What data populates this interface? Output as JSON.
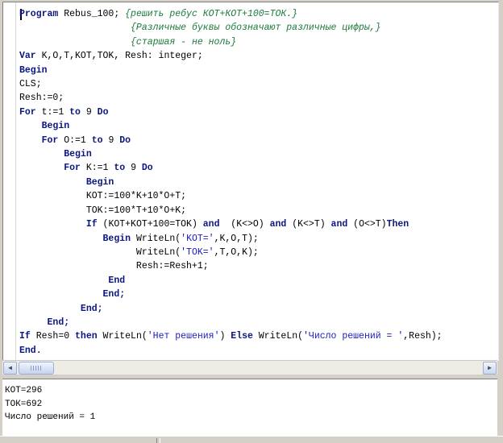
{
  "editor": {
    "lines": [
      [
        {
          "t": "Program",
          "c": "kw"
        },
        {
          "t": " Rebus_100; ",
          "c": "pl"
        },
        {
          "t": "{решить ребус КОТ+КОТ+100=ТОК.}",
          "c": "cm"
        }
      ],
      [
        {
          "t": "                    ",
          "c": "pl"
        },
        {
          "t": "{Различные буквы обозначают различные цифры,}",
          "c": "cm"
        }
      ],
      [
        {
          "t": "                    ",
          "c": "pl"
        },
        {
          "t": "{старшая - не ноль}",
          "c": "cm"
        }
      ],
      [
        {
          "t": "Var",
          "c": "kw"
        },
        {
          "t": " K,O,T,KOT,TOK, Resh: integer;",
          "c": "pl"
        }
      ],
      [
        {
          "t": "Begin",
          "c": "kw"
        }
      ],
      [
        {
          "t": "CLS;",
          "c": "pl"
        }
      ],
      [
        {
          "t": "Resh:=0;",
          "c": "pl"
        }
      ],
      [
        {
          "t": "For",
          "c": "kw"
        },
        {
          "t": " t:=1 ",
          "c": "pl"
        },
        {
          "t": "to",
          "c": "kw"
        },
        {
          "t": " 9 ",
          "c": "pl"
        },
        {
          "t": "Do",
          "c": "kw"
        }
      ],
      [
        {
          "t": "    ",
          "c": "pl"
        },
        {
          "t": "Begin",
          "c": "kw"
        }
      ],
      [
        {
          "t": "    ",
          "c": "pl"
        },
        {
          "t": "For",
          "c": "kw"
        },
        {
          "t": " O:=1 ",
          "c": "pl"
        },
        {
          "t": "to",
          "c": "kw"
        },
        {
          "t": " 9 ",
          "c": "pl"
        },
        {
          "t": "Do",
          "c": "kw"
        }
      ],
      [
        {
          "t": "        ",
          "c": "pl"
        },
        {
          "t": "Begin",
          "c": "kw"
        }
      ],
      [
        {
          "t": "        ",
          "c": "pl"
        },
        {
          "t": "For",
          "c": "kw"
        },
        {
          "t": " K:=1 ",
          "c": "pl"
        },
        {
          "t": "to",
          "c": "kw"
        },
        {
          "t": " 9 ",
          "c": "pl"
        },
        {
          "t": "Do",
          "c": "kw"
        }
      ],
      [
        {
          "t": "            ",
          "c": "pl"
        },
        {
          "t": "Begin",
          "c": "kw"
        }
      ],
      [
        {
          "t": "            KOT:=100*K+10*O+T;",
          "c": "pl"
        }
      ],
      [
        {
          "t": "            TOK:=100*T+10*O+K;",
          "c": "pl"
        }
      ],
      [
        {
          "t": "            ",
          "c": "pl"
        },
        {
          "t": "If",
          "c": "kw"
        },
        {
          "t": " (KOT+KOT+100=TOK) ",
          "c": "pl"
        },
        {
          "t": "and",
          "c": "kw"
        },
        {
          "t": "  (K<>O) ",
          "c": "pl"
        },
        {
          "t": "and",
          "c": "kw"
        },
        {
          "t": " (K<>T) ",
          "c": "pl"
        },
        {
          "t": "and",
          "c": "kw"
        },
        {
          "t": " (O<>T)",
          "c": "pl"
        },
        {
          "t": "Then",
          "c": "kw"
        }
      ],
      [
        {
          "t": "               ",
          "c": "pl"
        },
        {
          "t": "Begin",
          "c": "kw"
        },
        {
          "t": " WriteLn(",
          "c": "pl"
        },
        {
          "t": "'KOT='",
          "c": "st"
        },
        {
          "t": ",K,O,T);",
          "c": "pl"
        }
      ],
      [
        {
          "t": "                     WriteLn(",
          "c": "pl"
        },
        {
          "t": "'TOK='",
          "c": "st"
        },
        {
          "t": ",T,O,K);",
          "c": "pl"
        }
      ],
      [
        {
          "t": "                     Resh:=Resh+1;",
          "c": "pl"
        }
      ],
      [
        {
          "t": "                ",
          "c": "pl"
        },
        {
          "t": "End",
          "c": "kw"
        }
      ],
      [
        {
          "t": "               ",
          "c": "pl"
        },
        {
          "t": "End;",
          "c": "kw"
        }
      ],
      [
        {
          "t": "           ",
          "c": "pl"
        },
        {
          "t": "End;",
          "c": "kw"
        }
      ],
      [
        {
          "t": "     ",
          "c": "pl"
        },
        {
          "t": "End;",
          "c": "kw"
        }
      ],
      [
        {
          "t": "If",
          "c": "kw"
        },
        {
          "t": " Resh=0 ",
          "c": "pl"
        },
        {
          "t": "then",
          "c": "kw"
        },
        {
          "t": " WriteLn(",
          "c": "pl"
        },
        {
          "t": "'Нет решения'",
          "c": "st"
        },
        {
          "t": ") ",
          "c": "pl"
        },
        {
          "t": "Else",
          "c": "kw"
        },
        {
          "t": " WriteLn(",
          "c": "pl"
        },
        {
          "t": "'Число решений = '",
          "c": "st"
        },
        {
          "t": ",Resh);",
          "c": "pl"
        }
      ],
      [
        {
          "t": "End.",
          "c": "kw"
        }
      ]
    ]
  },
  "scrollbar": {
    "left_arrow_icon": "triangle-left-icon",
    "right_arrow_icon": "triangle-right-icon",
    "left_glyph": "◀",
    "right_glyph": "▶"
  },
  "output": {
    "lines": [
      "КОТ=296",
      "ТОК=692",
      "Число решений = 1"
    ]
  },
  "colors": {
    "keyword": "#0b1680",
    "comment": "#1a7a3a",
    "string": "#1c1cbe"
  }
}
